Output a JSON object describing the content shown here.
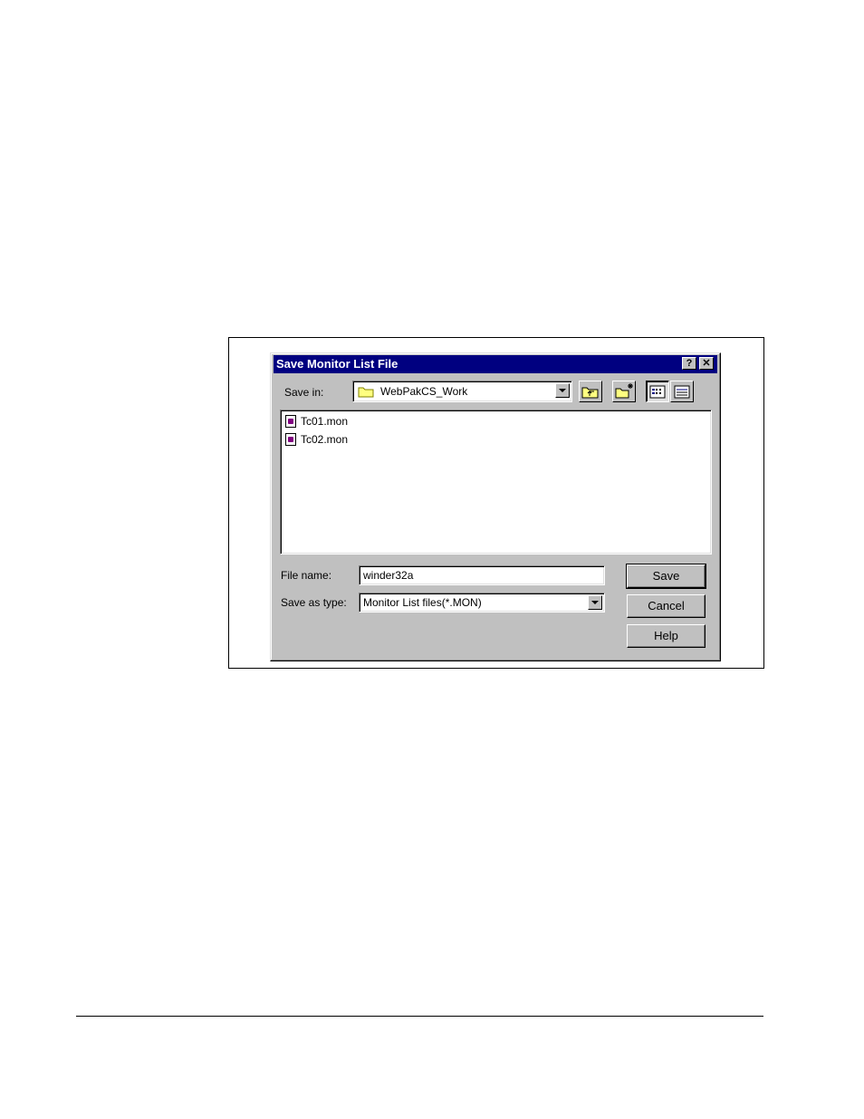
{
  "dialog": {
    "title": "Save Monitor List File",
    "help_button": "?",
    "close_button": "✕",
    "save_in_label": "Save in:",
    "save_in_value": "WebPakCS_Work",
    "files": [
      "Tc01.mon",
      "Tc02.mon"
    ],
    "file_name_label": "File name:",
    "file_name_value": "winder32a",
    "save_as_type_label": "Save as type:",
    "save_as_type_value": "Monitor List files(*.MON)",
    "save_button": "Save",
    "cancel_button": "Cancel",
    "help_btn": "Help"
  },
  "colors": {
    "titlebar": "#000080",
    "dialog_bg": "#c0c0c0",
    "folder": "#ffff80"
  },
  "icons": [
    "folder-icon",
    "up-one-level-icon",
    "create-new-folder-icon",
    "list-view-icon",
    "details-view-icon",
    "mon-file-icon"
  ]
}
